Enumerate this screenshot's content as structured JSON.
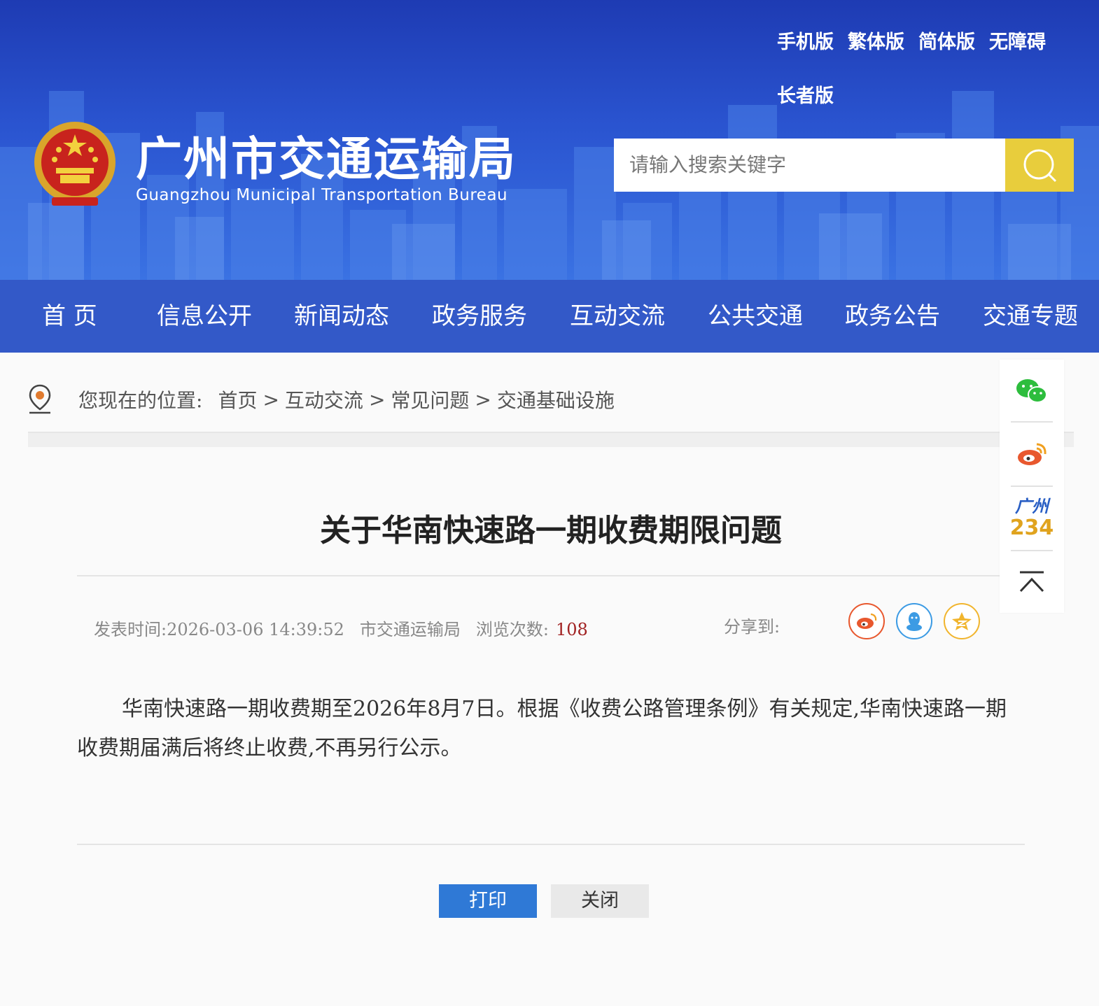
{
  "header": {
    "top_links": [
      "手机版",
      "繁体版",
      "简体版",
      "无障碍",
      "长者版"
    ],
    "site_title": "广州市交通运输局",
    "site_subtitle": "Guangzhou Municipal Transportation Bureau",
    "search_placeholder": "请输入搜索关键字",
    "search_icon": "search-icon"
  },
  "nav": {
    "items": [
      "首 页",
      "信息公开",
      "新闻动态",
      "政务服务",
      "互动交流",
      "公共交通",
      "政务公告",
      "交通专题"
    ]
  },
  "breadcrumb": {
    "label": "您现在的位置:",
    "items": [
      "首页",
      "互动交流",
      "常见问题",
      "交通基础设施"
    ],
    "separator": ">"
  },
  "article": {
    "title": "关于华南快速路一期收费期限问题",
    "publish_time": "发表时间:2026-03-06 14:39:52",
    "source": "市交通运输局",
    "views_label": "浏览次数:",
    "views": "108",
    "share_label": "分享到:",
    "body": "华南快速路一期收费期至2026年8月7日。根据《收费公路管理条例》有关规定,华南快速路一期收费期届满后将终止收费,不再另行公示。"
  },
  "actions": {
    "print": "打印",
    "close": "关闭"
  },
  "float_bar": {
    "gz234_line1": "广州",
    "gz234_line2": "234"
  },
  "colors": {
    "banner": "#2a54d0",
    "nav": "#3359c8",
    "search_button": "#e8cd3c",
    "print_button": "#2f79d6",
    "views_count": "#a12222"
  }
}
